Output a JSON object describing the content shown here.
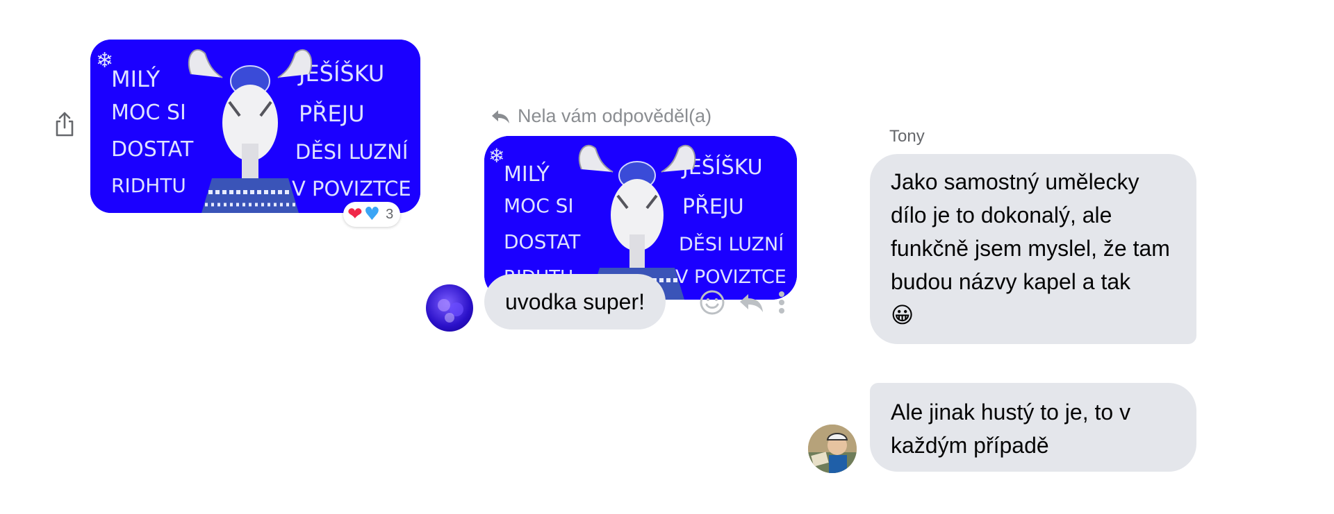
{
  "image_text": {
    "line1_left": "MILÝ",
    "line1_right": "JEŠÍŠKU",
    "line2_left": "MOC SI",
    "line2_right": "PŘEJU",
    "line3_left": "DOSTAT",
    "line3_right": "DĚSI LUZNÍ",
    "line4_left": "RIDHTU",
    "line4_right": "V POVIZTCE"
  },
  "shared_image": {
    "reactions": {
      "emojis": [
        "❤",
        "♥"
      ],
      "count": "3"
    }
  },
  "reply": {
    "header": "Nela vám odpověděl(a)",
    "message": "uvodka super!"
  },
  "tony": {
    "name": "Tony",
    "message_1": "Jako samostný umělecky dílo je to dokonalý, ale funkčně jsem myslel, že tam budou názvy kapel a tak",
    "message_1_emoji": "😀",
    "message_2": "Ale jinak hustý to je, to v každým případě"
  },
  "colors": {
    "image_bg": "#1b00ff",
    "bubble_bg": "#e4e6eb",
    "meta_text": "#8a8d91"
  },
  "icons": {
    "share": "share-icon",
    "reply_arrow": "reply-arrow-icon",
    "react": "smiley-icon",
    "reply": "reply-icon",
    "more": "more-vertical-icon"
  }
}
